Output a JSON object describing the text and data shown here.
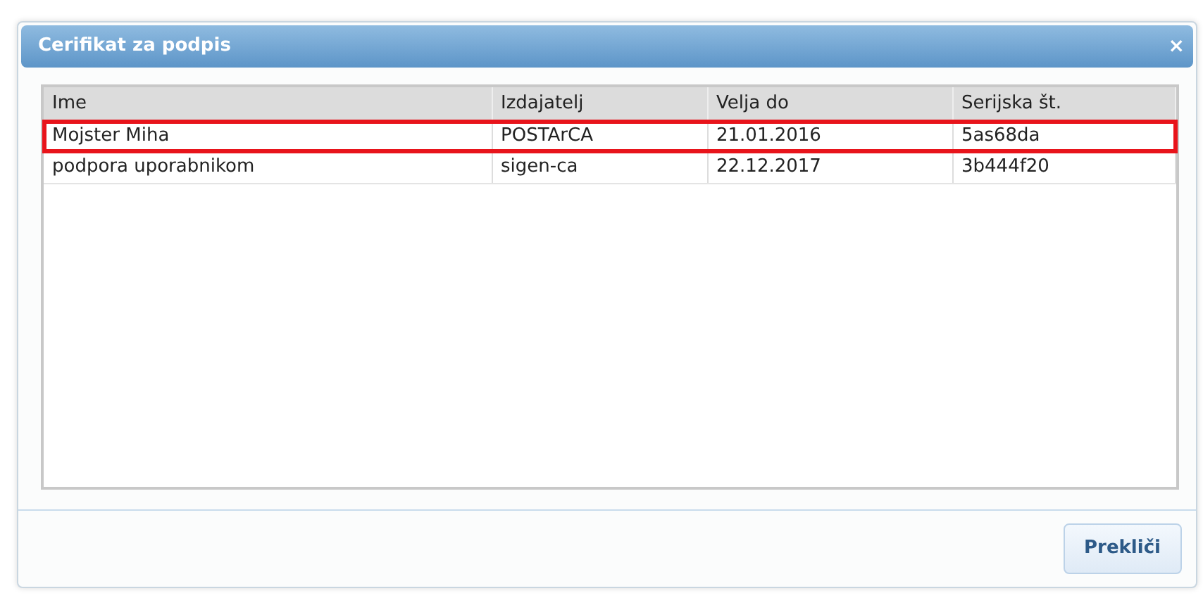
{
  "dialog": {
    "title": "Cerifikat za podpis",
    "close": "×"
  },
  "table": {
    "columns": [
      "Ime",
      "Izdajatelj",
      "Velja do",
      "Serijska št."
    ],
    "rows": [
      {
        "cells": [
          "Mojster Miha",
          "POSTArCA",
          "21.01.2016",
          "5as68da"
        ],
        "selected": true
      },
      {
        "cells": [
          "podpora uporabnikom",
          "sigen-ca",
          "22.12.2017",
          "3b444f20"
        ],
        "selected": false
      }
    ]
  },
  "buttons": [
    "Prekliči"
  ]
}
